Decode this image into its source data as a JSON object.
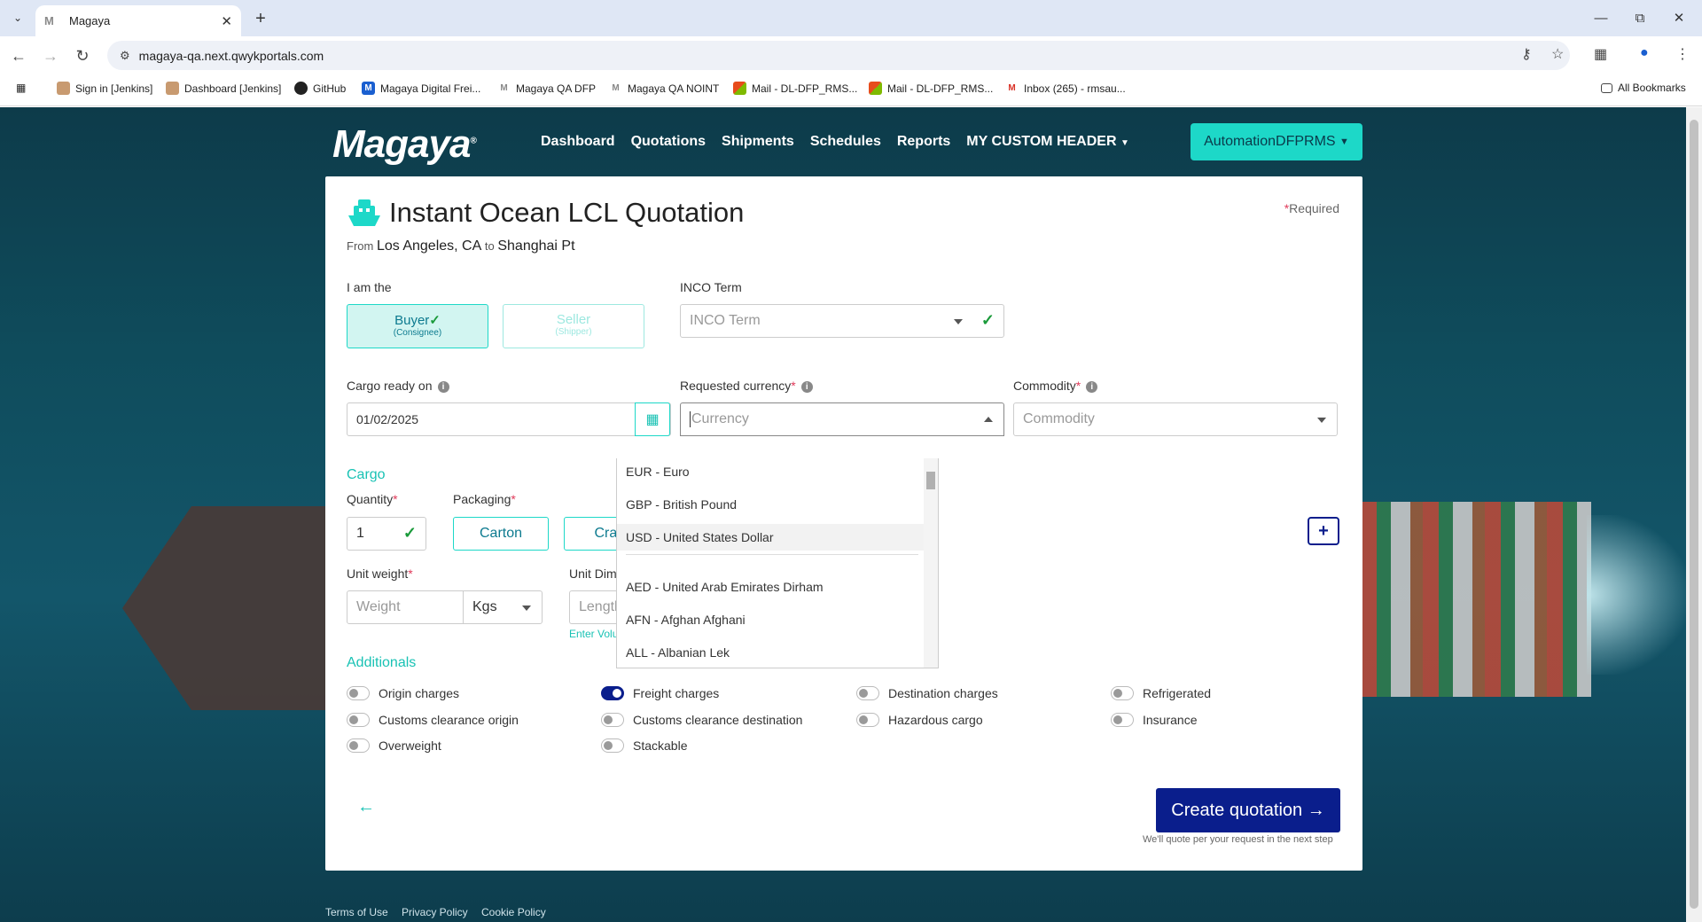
{
  "browser": {
    "tab_title": "Magaya",
    "tab_favicon": "M",
    "url": "magaya-qa.next.qwykportals.com",
    "bookmarks": [
      {
        "icon": "jenkins-icon",
        "label": "Sign in [Jenkins]"
      },
      {
        "icon": "jenkins-icon",
        "label": "Dashboard [Jenkins]"
      },
      {
        "icon": "github-icon",
        "label": "GitHub"
      },
      {
        "icon": "magaya-icon",
        "label": "Magaya Digital Frei..."
      },
      {
        "icon": "magaya-icon",
        "label": "Magaya QA DFP"
      },
      {
        "icon": "magaya-icon",
        "label": "Magaya QA NOINT"
      },
      {
        "icon": "office-icon",
        "label": "Mail - DL-DFP_RMS..."
      },
      {
        "icon": "office-icon",
        "label": "Mail - DL-DFP_RMS..."
      },
      {
        "icon": "gmail-icon",
        "label": "Inbox (265) - rmsau..."
      }
    ],
    "all_bookmarks": "All Bookmarks"
  },
  "header": {
    "logo": "Magaya",
    "nav": [
      "Dashboard",
      "Quotations",
      "Shipments",
      "Schedules",
      "Reports",
      "MY CUSTOM HEADER"
    ],
    "user": "AutomationDFPRMS"
  },
  "form": {
    "required_note": "Required",
    "title": "Instant Ocean LCL Quotation",
    "route_from_prefix": "From",
    "route_origin": "Los Angeles, CA",
    "route_to_prefix": "to",
    "route_destination": "Shanghai Pt",
    "role_label": "I am the",
    "buyer": {
      "main": "Buyer",
      "sub": "(Consignee)"
    },
    "seller": {
      "main": "Seller",
      "sub": "(Shipper)"
    },
    "inco_label": "INCO Term",
    "inco_placeholder": "INCO Term",
    "cargo_ready_label": "Cargo ready on",
    "cargo_ready_value": "01/02/2025",
    "currency_label": "Requested currency",
    "currency_placeholder": "Currency",
    "commodity_label": "Commodity",
    "commodity_placeholder": "Commodity",
    "cargo_section": "Cargo",
    "quantity_label": "Quantity",
    "quantity_value": "1",
    "packaging_label": "Packaging",
    "packaging_options": [
      "Carton",
      "Crate"
    ],
    "unit_weight_label": "Unit weight",
    "weight_placeholder": "Weight",
    "weight_unit": "Kgs",
    "unit_dimensions_label": "Unit Dimensions",
    "length_placeholder": "Length",
    "enter_volume": "Enter Volume",
    "additionals_section": "Additionals",
    "additionals": [
      {
        "label": "Origin charges",
        "on": false
      },
      {
        "label": "Freight charges",
        "on": true
      },
      {
        "label": "Destination charges",
        "on": false
      },
      {
        "label": "Refrigerated",
        "on": false
      },
      {
        "label": "Customs clearance origin",
        "on": false
      },
      {
        "label": "Customs clearance destination",
        "on": false
      },
      {
        "label": "Hazardous cargo",
        "on": false
      },
      {
        "label": "Insurance",
        "on": false
      },
      {
        "label": "Overweight",
        "on": false
      },
      {
        "label": "Stackable",
        "on": false
      }
    ],
    "create_button": "Create quotation",
    "create_note": "We'll quote per your request in the next step"
  },
  "currency_dropdown": {
    "items": [
      "EUR - Euro",
      "GBP - British Pound",
      "USD - United States Dollar",
      "AED - United Arab Emirates Dirham",
      "AFN - Afghan Afghani",
      "ALL - Albanian Lek"
    ],
    "highlighted": "USD - United States Dollar"
  },
  "footer": [
    "Terms of Use",
    "Privacy Policy",
    "Cookie Policy"
  ],
  "colors": {
    "accent": "#1dd8c8",
    "primary": "#0a1e8c",
    "required": "#e03a5a"
  }
}
